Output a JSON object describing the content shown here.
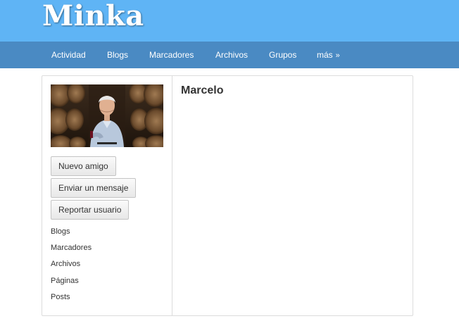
{
  "site": {
    "title": "Minka"
  },
  "nav": {
    "items": [
      {
        "label": "Actividad"
      },
      {
        "label": "Blogs"
      },
      {
        "label": "Marcadores"
      },
      {
        "label": "Archivos"
      },
      {
        "label": "Grupos"
      }
    ],
    "more": {
      "label": "más",
      "icon": "»"
    }
  },
  "profile": {
    "name": "Marcelo",
    "actions": [
      {
        "label": "Nuevo amigo"
      },
      {
        "label": "Enviar un mensaje"
      },
      {
        "label": "Reportar usuario"
      }
    ],
    "links": [
      {
        "label": "Blogs"
      },
      {
        "label": "Marcadores"
      },
      {
        "label": "Archivos"
      },
      {
        "label": "Páginas"
      },
      {
        "label": "Posts"
      }
    ]
  },
  "colors": {
    "header": "#5fb4f5",
    "navbar": "#4a8ac3"
  }
}
